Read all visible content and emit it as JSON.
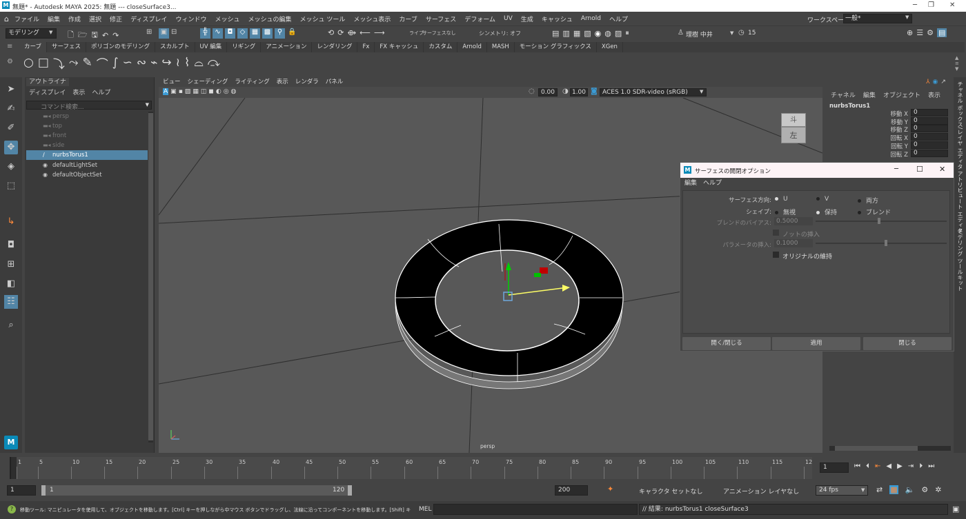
{
  "window": {
    "title": "無題* - Autodesk MAYA 2025: 無題   ---   closeSurface3..."
  },
  "menubar": {
    "items": [
      "ファイル",
      "編集",
      "作成",
      "選択",
      "修正",
      "ディスプレイ",
      "ウィンドウ",
      "メッシュ",
      "メッシュの編集",
      "メッシュ ツール",
      "メッシュ表示",
      "カーブ",
      "サーフェス",
      "デフォーム",
      "UV",
      "生成",
      "キャッシュ",
      "Arnold",
      "ヘルプ"
    ],
    "workspace_label": "ワークスペース:",
    "workspace_value": "一般*"
  },
  "statusline": {
    "mode": "モデリング",
    "live": "ライブ",
    "live_value": "サーフェスなし",
    "symmetry": "シンメトリ: オフ",
    "user": "理樹 中井",
    "time_value": "15"
  },
  "shelf": {
    "tabs": [
      "カーブ",
      "サーフェス",
      "ポリゴンのモデリング",
      "スカルプト",
      "UV 編集",
      "リギング",
      "アニメーション",
      "レンダリング",
      "Fx",
      "FX キャッシュ",
      "カスタム",
      "Arnold",
      "MASH",
      "モーション グラフィックス",
      "XGen"
    ]
  },
  "outliner": {
    "tab": "アウトライナ",
    "menu": [
      "ディスプレイ",
      "表示",
      "ヘルプ"
    ],
    "search_placeholder": "コマンド検索...",
    "items": [
      {
        "label": "persp",
        "dim": true
      },
      {
        "label": "top",
        "dim": true
      },
      {
        "label": "front",
        "dim": true
      },
      {
        "label": "side",
        "dim": true
      },
      {
        "label": "nurbsTorus1",
        "selected": true
      },
      {
        "label": "defaultLightSet"
      },
      {
        "label": "defaultObjectSet"
      }
    ]
  },
  "viewport": {
    "menu": [
      "ビュー",
      "シェーディング",
      "ライティング",
      "表示",
      "レンダラ",
      "パネル"
    ],
    "near_value": "0.00",
    "far_value": "1.00",
    "colorspace": "ACES 1.0 SDR-video (sRGB)",
    "camera_label": "persp",
    "viewcube_top": "斗",
    "viewcube_left": "左"
  },
  "channelbox": {
    "menu": [
      "チャネル",
      "編集",
      "オブジェクト",
      "表示"
    ],
    "object": "nurbsTorus1",
    "channels": [
      {
        "label": "移動 X",
        "value": "0"
      },
      {
        "label": "移動 Y",
        "value": "0"
      },
      {
        "label": "移動 Z",
        "value": "0"
      },
      {
        "label": "回転 X",
        "value": "0"
      },
      {
        "label": "回転 Y",
        "value": "0"
      },
      {
        "label": "回転 Z",
        "value": "0"
      }
    ]
  },
  "sidetabs": [
    "チャネル ボックス/レイヤ エディタ",
    "アトリビュート エディタ",
    "モデリング ツールキット"
  ],
  "dialog": {
    "title": "サーフェスの開閉オプション",
    "menu": [
      "編集",
      "ヘルプ"
    ],
    "surface_dir_label": "サーフェス方向:",
    "surface_dir_options": [
      {
        "label": "U",
        "on": true
      },
      {
        "label": "V",
        "on": false
      },
      {
        "label": "両方",
        "on": false
      }
    ],
    "shape_label": "シェイプ:",
    "shape_options": [
      {
        "label": "無視",
        "on": false
      },
      {
        "label": "保持",
        "on": true
      },
      {
        "label": "ブレンド",
        "on": false
      }
    ],
    "blend_bias_label": "ブレンドのバイアス:",
    "blend_bias_value": "0.5000",
    "insert_knot_label": "ノットの挿入",
    "param_insert_label": "パラメータの挿入:",
    "param_insert_value": "0.1000",
    "keep_original_label": "オリジナルの維持",
    "buttons": [
      "開く/閉じる",
      "適用",
      "閉じる"
    ]
  },
  "timeline": {
    "ticks": [
      "1",
      "5",
      "10",
      "15",
      "20",
      "25",
      "30",
      "35",
      "40",
      "45",
      "50",
      "55",
      "60",
      "65",
      "70",
      "75",
      "80",
      "85",
      "90",
      "95",
      "100",
      "105",
      "110",
      "115",
      "12"
    ],
    "current_frame": "1"
  },
  "range": {
    "start": "1",
    "inner_start": "1",
    "inner_end": "120",
    "end": "200",
    "character_set": "キャラクタ セットなし",
    "anim_layer": "アニメーション レイヤなし",
    "fps": "24 fps"
  },
  "helpline": {
    "message": "移動ツール: マニピュレータを使用して、オブジェクトを移動します。[Ctrl] キーを押しながら中マウス ボタンでドラッグし、法線に沿ってコンポーネントを移動します。[Shift] キーを押しながらマニピ",
    "mel_label": "MEL",
    "result": "// 結果: nurbsTorus1 closeSurface3"
  },
  "colors": {
    "selection": "#5285a6",
    "accent_blue": "#3a9bd5",
    "keyframe_orange": "#ff8a3a"
  }
}
